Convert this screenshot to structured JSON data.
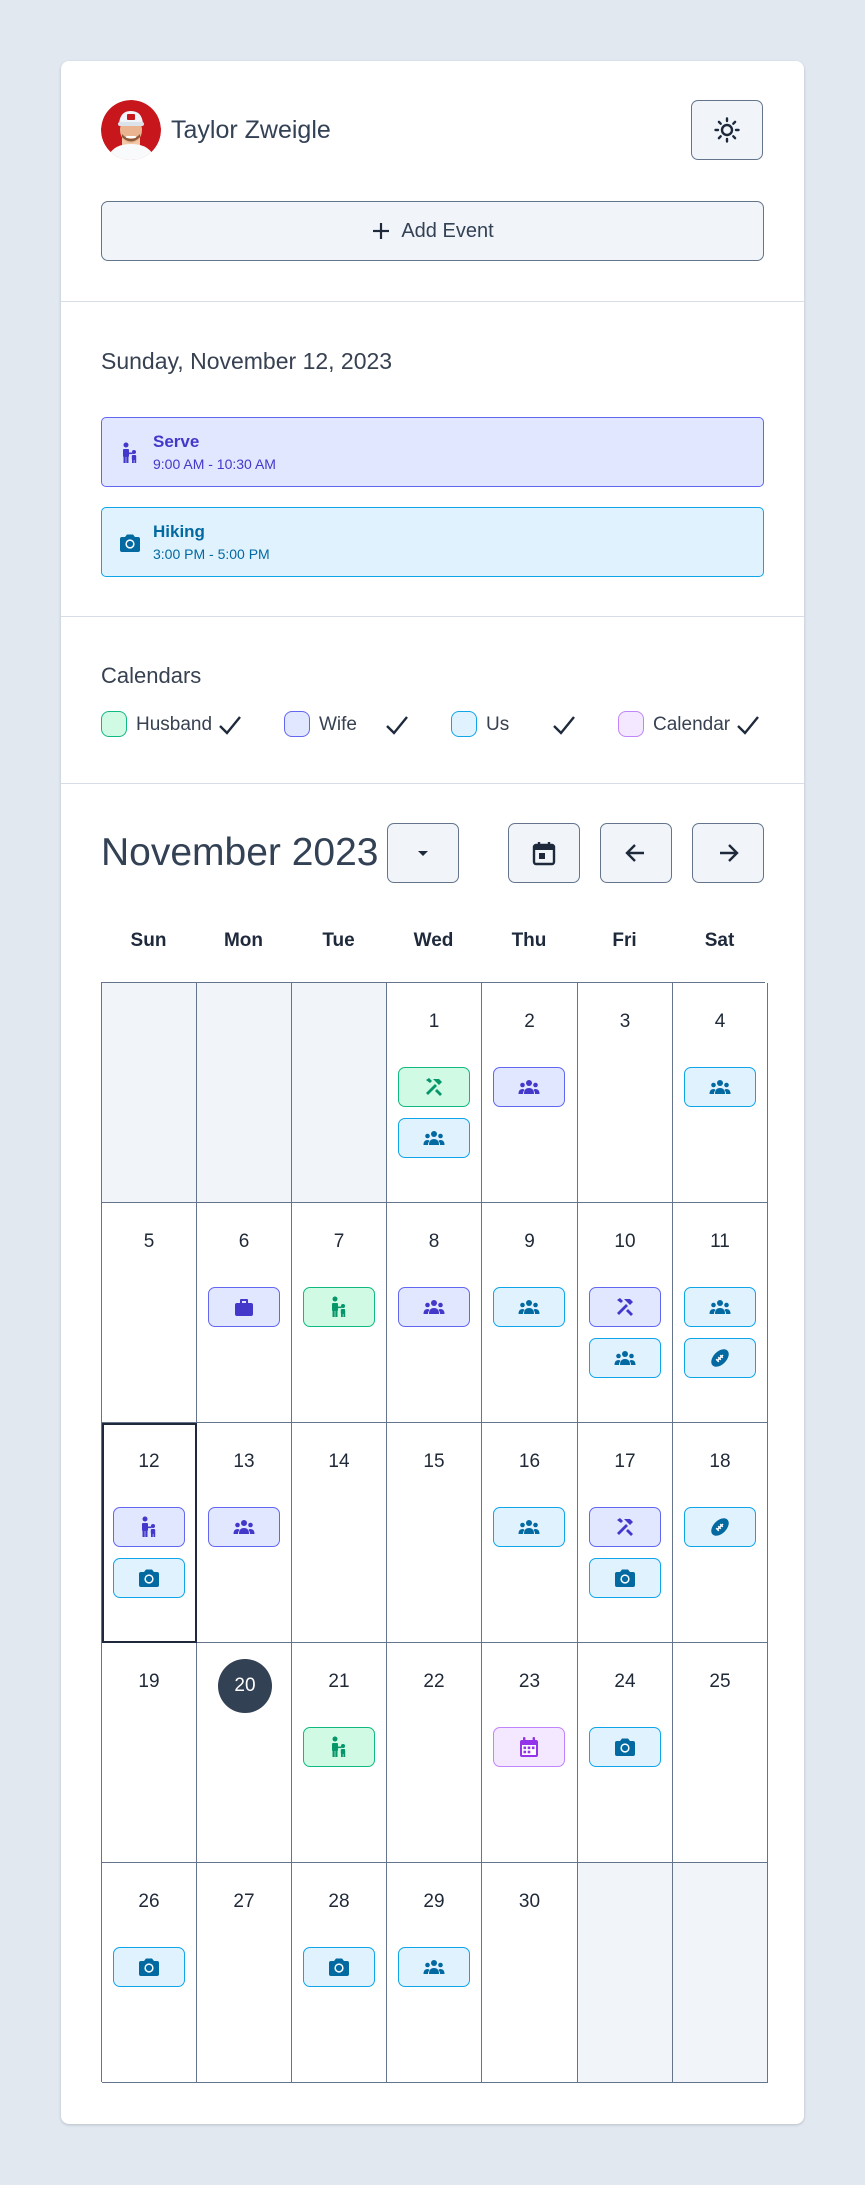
{
  "header": {
    "user_name": "Taylor Zweigle",
    "theme_toggle_icon": "sun-icon",
    "add_event_label": "Add Event"
  },
  "selected_day": {
    "date_label": "Sunday, November 12, 2023",
    "events": [
      {
        "title": "Serve",
        "time": "9:00 AM - 10:30 AM",
        "icon": "parent-child-icon",
        "calendar": "Wife"
      },
      {
        "title": "Hiking",
        "time": "3:00 PM - 5:00 PM",
        "icon": "camera-icon",
        "calendar": "Us"
      }
    ]
  },
  "calendars": {
    "title": "Calendars",
    "items": [
      {
        "label": "Husband",
        "checked": true,
        "color": "#10b981"
      },
      {
        "label": "Wife",
        "checked": true,
        "color": "#6366f1"
      },
      {
        "label": "Us",
        "checked": true,
        "color": "#0ea5e9"
      },
      {
        "label": "Calendar",
        "checked": true,
        "color": "#c084fc"
      }
    ]
  },
  "month_view": {
    "title": "November 2023",
    "controls": {
      "dropdown_icon": "caret-down-icon",
      "today_icon": "calendar-icon",
      "prev_icon": "arrow-left-icon",
      "next_icon": "arrow-right-icon"
    },
    "weekdays": [
      "Sun",
      "Mon",
      "Tue",
      "Wed",
      "Thu",
      "Fri",
      "Sat"
    ],
    "today": 20,
    "selected": 12,
    "days": [
      {
        "day": "1",
        "events": [
          {
            "cal": "Husband",
            "icon": "tools-icon"
          },
          {
            "cal": "Us",
            "icon": "people-group-icon"
          }
        ]
      },
      {
        "day": "2",
        "events": [
          {
            "cal": "Wife",
            "icon": "people-group-icon"
          }
        ]
      },
      {
        "day": "3",
        "events": []
      },
      {
        "day": "4",
        "events": [
          {
            "cal": "Us",
            "icon": "people-group-icon"
          }
        ]
      },
      {
        "day": "5",
        "events": []
      },
      {
        "day": "6",
        "events": [
          {
            "cal": "Wife",
            "icon": "briefcase-icon"
          }
        ]
      },
      {
        "day": "7",
        "events": [
          {
            "cal": "Husband",
            "icon": "parent-child-icon"
          }
        ]
      },
      {
        "day": "8",
        "events": [
          {
            "cal": "Wife",
            "icon": "people-group-icon"
          }
        ]
      },
      {
        "day": "9",
        "events": [
          {
            "cal": "Us",
            "icon": "people-group-icon"
          }
        ]
      },
      {
        "day": "10",
        "events": [
          {
            "cal": "Wife",
            "icon": "tools-icon"
          },
          {
            "cal": "Us",
            "icon": "people-group-icon"
          }
        ]
      },
      {
        "day": "11",
        "events": [
          {
            "cal": "Us",
            "icon": "people-group-icon"
          },
          {
            "cal": "Us",
            "icon": "football-icon"
          }
        ]
      },
      {
        "day": "12",
        "events": [
          {
            "cal": "Wife",
            "icon": "parent-child-icon"
          },
          {
            "cal": "Us",
            "icon": "camera-icon"
          }
        ]
      },
      {
        "day": "13",
        "events": [
          {
            "cal": "Wife",
            "icon": "people-group-icon"
          }
        ]
      },
      {
        "day": "14",
        "events": []
      },
      {
        "day": "15",
        "events": []
      },
      {
        "day": "16",
        "events": [
          {
            "cal": "Us",
            "icon": "people-group-icon"
          }
        ]
      },
      {
        "day": "17",
        "events": [
          {
            "cal": "Wife",
            "icon": "tools-icon"
          },
          {
            "cal": "Us",
            "icon": "camera-icon"
          }
        ]
      },
      {
        "day": "18",
        "events": [
          {
            "cal": "Us",
            "icon": "football-icon"
          }
        ]
      },
      {
        "day": "19",
        "events": []
      },
      {
        "day": "20",
        "events": []
      },
      {
        "day": "21",
        "events": [
          {
            "cal": "Husband",
            "icon": "parent-child-icon"
          }
        ]
      },
      {
        "day": "22",
        "events": []
      },
      {
        "day": "23",
        "events": [
          {
            "cal": "Calendar",
            "icon": "calendar-icon"
          }
        ]
      },
      {
        "day": "24",
        "events": [
          {
            "cal": "Us",
            "icon": "camera-icon"
          }
        ]
      },
      {
        "day": "25",
        "events": []
      },
      {
        "day": "26",
        "events": [
          {
            "cal": "Us",
            "icon": "camera-icon"
          }
        ]
      },
      {
        "day": "27",
        "events": []
      },
      {
        "day": "28",
        "events": [
          {
            "cal": "Us",
            "icon": "camera-icon"
          }
        ]
      },
      {
        "day": "29",
        "events": [
          {
            "cal": "Us",
            "icon": "people-group-icon"
          }
        ]
      },
      {
        "day": "30",
        "events": []
      }
    ]
  },
  "colors": {
    "Husband": {
      "fg": "#059669",
      "bg": "#d1fae5",
      "border": "#10b981"
    },
    "Wife": {
      "fg": "#4338ca",
      "bg": "#e0e7ff",
      "border": "#6366f1"
    },
    "Us": {
      "fg": "#0369a1",
      "bg": "#e0f2fe",
      "border": "#0ea5e9"
    },
    "Calendar": {
      "fg": "#9333ea",
      "bg": "#f3e8ff",
      "border": "#c084fc"
    }
  }
}
